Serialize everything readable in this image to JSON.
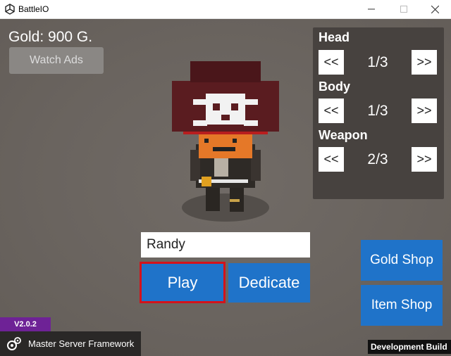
{
  "window": {
    "title": "BattleIO",
    "icons": {
      "app": "unity-icon",
      "minimize": "minimize-icon",
      "maximize": "maximize-icon",
      "close": "close-icon"
    }
  },
  "hud": {
    "gold": "Gold: 900 G.",
    "watch_ads": "Watch Ads"
  },
  "customize": {
    "prev": "<<",
    "next": ">>",
    "slots": [
      {
        "label": "Head",
        "value": "1/3"
      },
      {
        "label": "Body",
        "value": "1/3"
      },
      {
        "label": "Weapon",
        "value": "2/3"
      }
    ]
  },
  "player": {
    "name_value": "Randy"
  },
  "buttons": {
    "play": "Play",
    "dedicate": "Dedicate",
    "gold_shop": "Gold Shop",
    "item_shop": "Item Shop"
  },
  "footer": {
    "version": "V2.0.2",
    "framework": "Master Server Framework",
    "build": "Development Build"
  },
  "colors": {
    "background": "#6b6560",
    "panel": "#47423f",
    "button_blue": "#1f73c9",
    "play_outline": "#d4121a",
    "version_badge": "#6e2296"
  }
}
